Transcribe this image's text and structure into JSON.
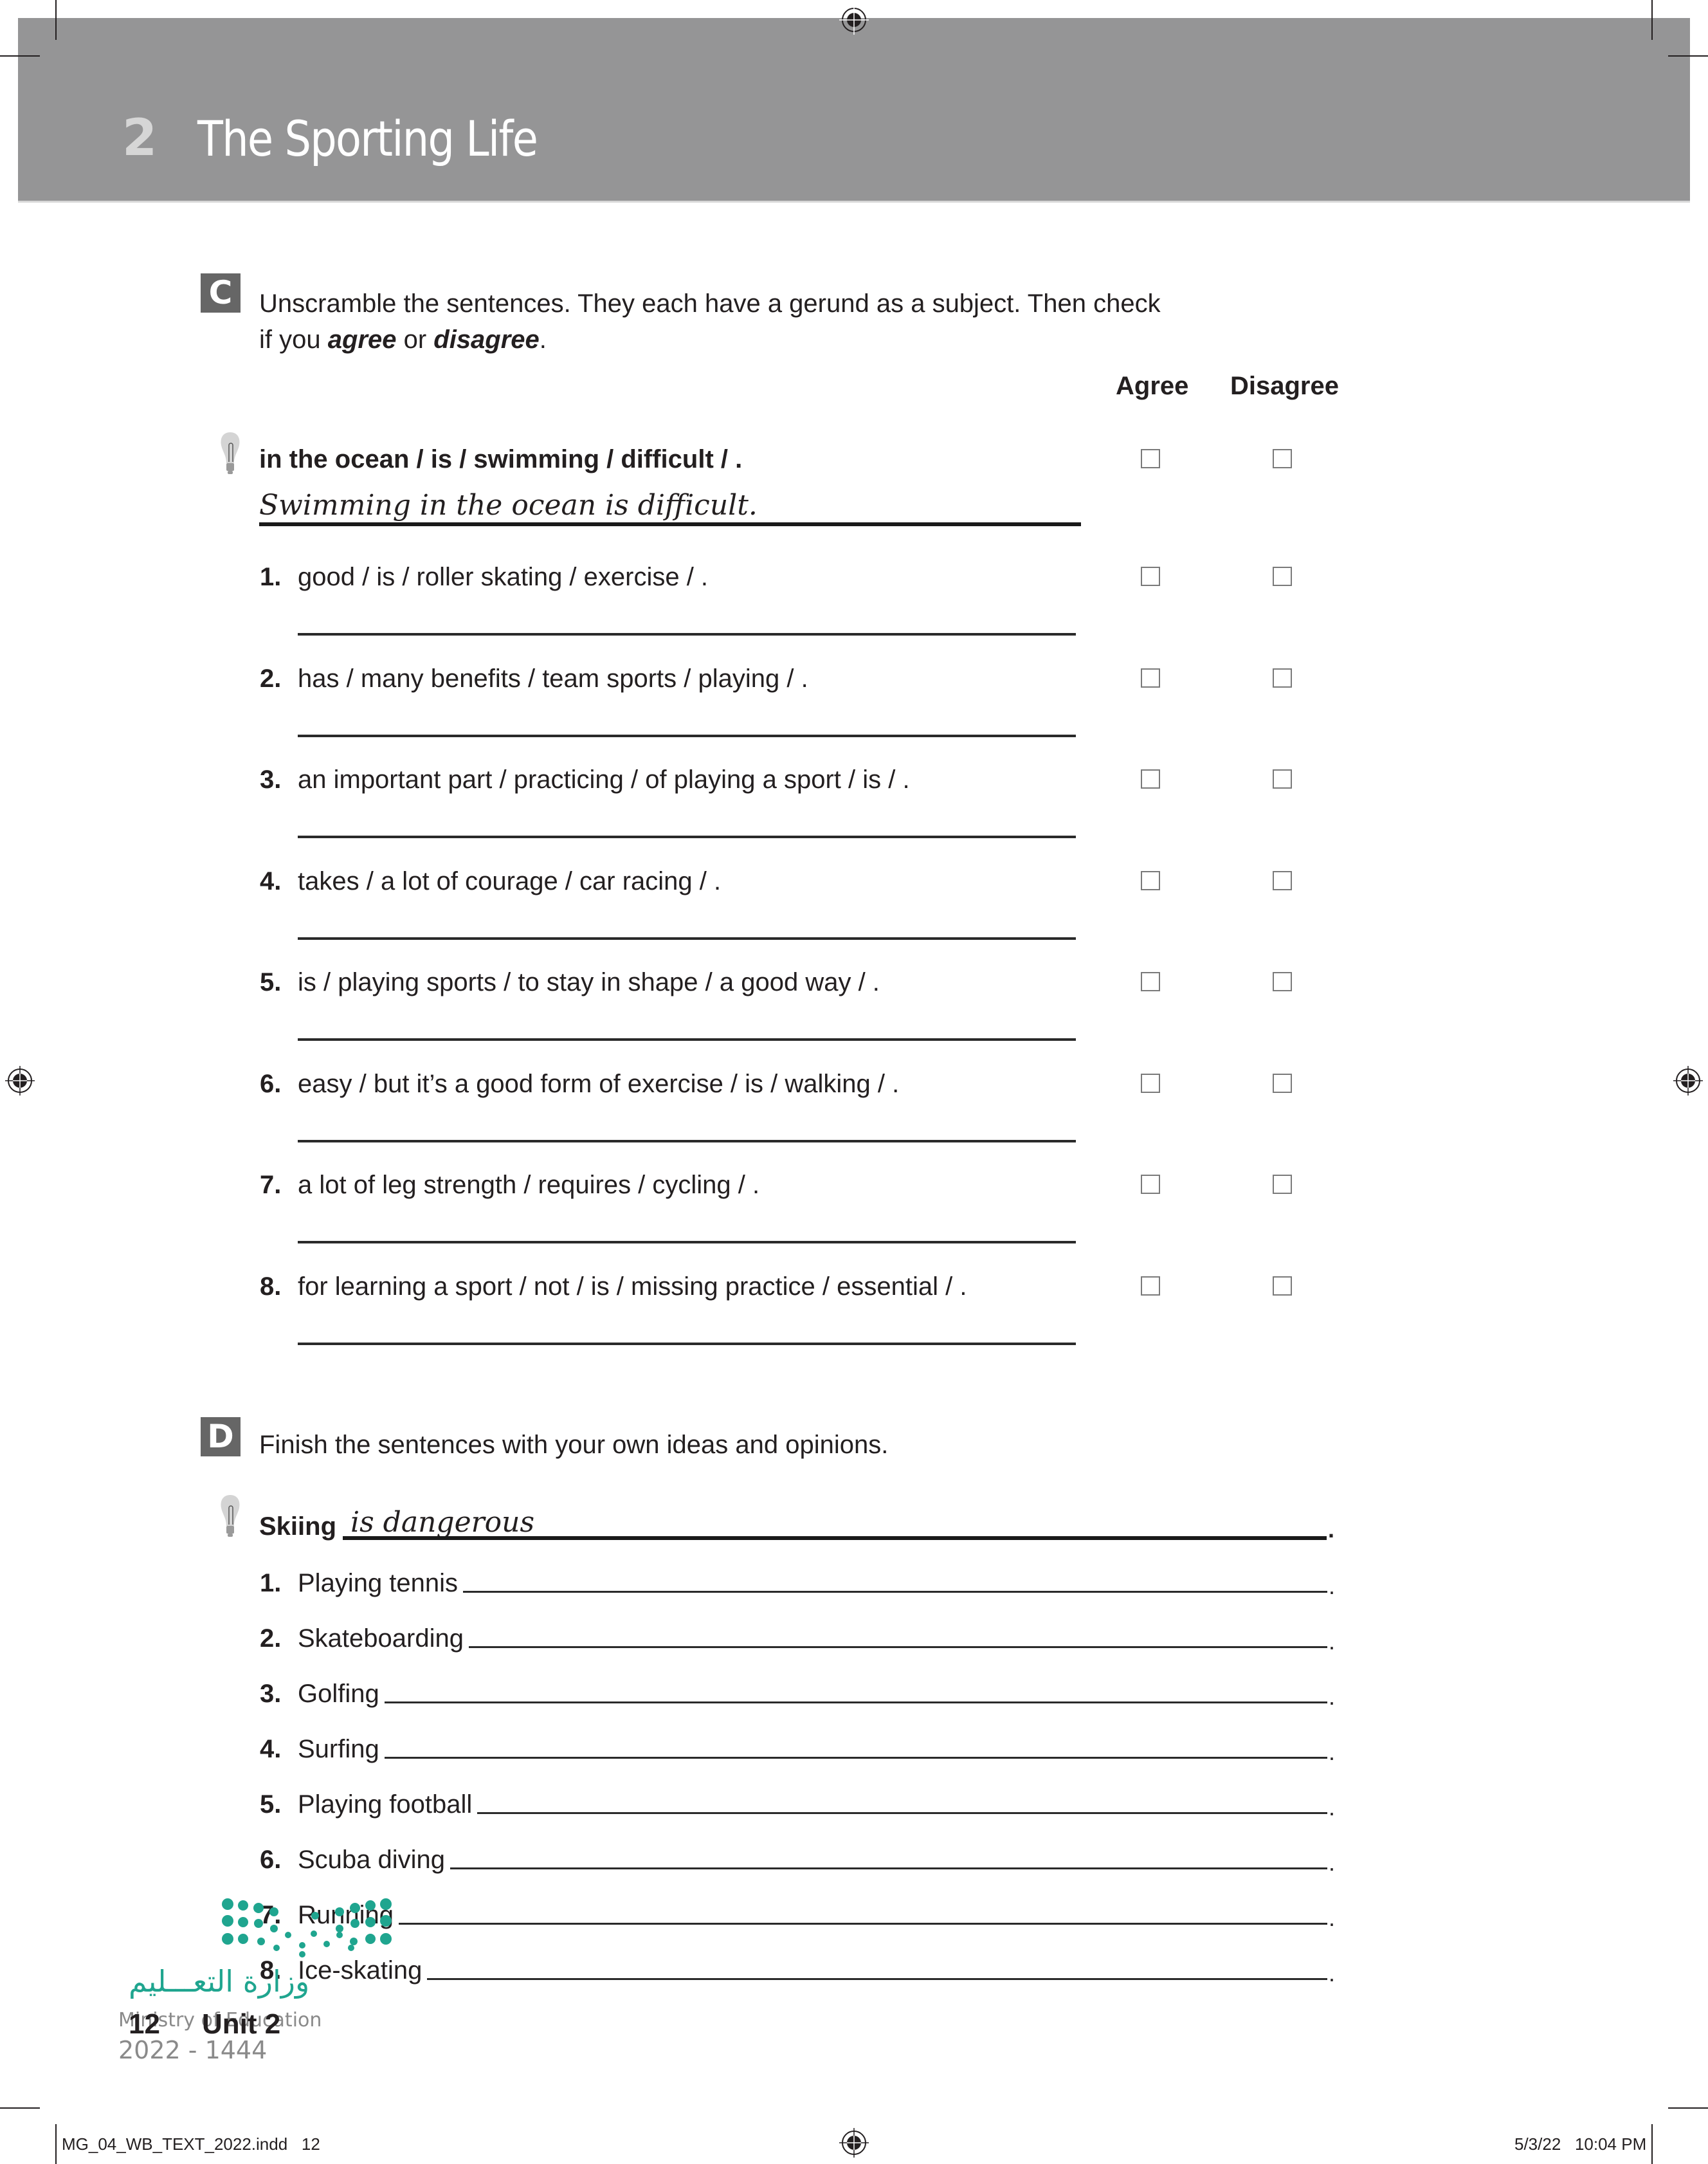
{
  "header": {
    "unit_number": "2",
    "unit_title": "The Sporting Life",
    "band_color": "#959596"
  },
  "section_c": {
    "badge": "C",
    "instruction_part1": "Unscramble the sentences. They each have a gerund as a subject. Then check",
    "instruction_part2_prefix": "if you ",
    "instruction_agree": "agree",
    "instruction_or": " or ",
    "instruction_disagree": "disagree",
    "instruction_end": ".",
    "col_agree": "Agree",
    "col_disagree": "Disagree",
    "example": {
      "icon": "lightbulb-icon",
      "prompt": "in the ocean / is / swimming / difficult / .",
      "answer": "Swimming in the ocean is difficult.",
      "agree_checked": false,
      "disagree_checked": false
    },
    "items": [
      {
        "num": "1.",
        "prompt": "good / is / roller skating / exercise / .",
        "answer": "",
        "agree_checked": false,
        "disagree_checked": false
      },
      {
        "num": "2.",
        "prompt": "has / many benefits / team sports / playing / .",
        "answer": "",
        "agree_checked": false,
        "disagree_checked": false
      },
      {
        "num": "3.",
        "prompt": "an important part / practicing / of playing a sport / is / .",
        "answer": "",
        "agree_checked": false,
        "disagree_checked": false
      },
      {
        "num": "4.",
        "prompt": "takes / a lot of courage / car racing / .",
        "answer": "",
        "agree_checked": false,
        "disagree_checked": false
      },
      {
        "num": "5.",
        "prompt": "is / playing sports / to stay in shape / a good way / .",
        "answer": "",
        "agree_checked": false,
        "disagree_checked": false
      },
      {
        "num": "6.",
        "prompt": "easy / but it’s a good form of exercise / is / walking / .",
        "answer": "",
        "agree_checked": false,
        "disagree_checked": false
      },
      {
        "num": "7.",
        "prompt": "a lot of leg strength / requires / cycling / .",
        "answer": "",
        "agree_checked": false,
        "disagree_checked": false
      },
      {
        "num": "8.",
        "prompt": "for learning a sport / not / is / missing practice / essential / .",
        "answer": "",
        "agree_checked": false,
        "disagree_checked": false
      }
    ]
  },
  "section_d": {
    "badge": "D",
    "instruction": "Finish the sentences with your own ideas and opinions.",
    "example": {
      "icon": "lightbulb-icon",
      "subject": "Skiing",
      "answer": "is dangerous",
      "end": "."
    },
    "items": [
      {
        "num": "1.",
        "subject": "Playing tennis",
        "answer": "",
        "end": "."
      },
      {
        "num": "2.",
        "subject": "Skateboarding",
        "answer": "",
        "end": "."
      },
      {
        "num": "3.",
        "subject": "Golfing",
        "answer": "",
        "end": "."
      },
      {
        "num": "4.",
        "subject": "Surfing",
        "answer": "",
        "end": "."
      },
      {
        "num": "5.",
        "subject": "Playing football",
        "answer": "",
        "end": "."
      },
      {
        "num": "6.",
        "subject": "Scuba diving",
        "answer": "",
        "end": "."
      },
      {
        "num": "7.",
        "subject": "Running",
        "answer": "",
        "end": "."
      },
      {
        "num": "8.",
        "subject": "Ice-skating",
        "answer": "",
        "end": "."
      }
    ]
  },
  "footer": {
    "page_number": "12",
    "unit_label": "Unit 2",
    "logo_arabic": "وزارة التعـــليم",
    "logo_english": "Ministry of Education",
    "logo_year": "2022 - 1444",
    "logo_color": "#1fa58f",
    "slug_file": "MG_04_WB_TEXT_2022.indd   12",
    "slug_datetime": "5/3/22   10:04 PM"
  }
}
